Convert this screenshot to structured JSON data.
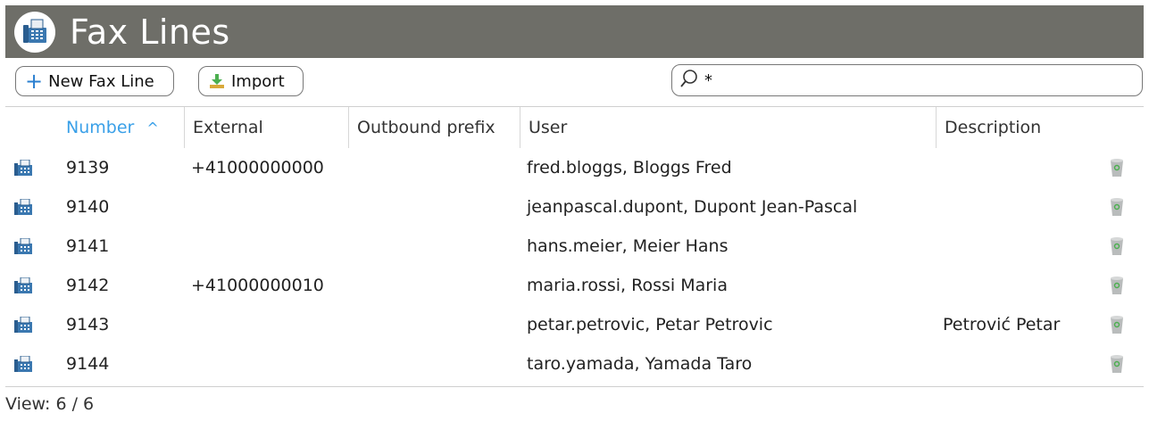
{
  "window": {
    "title": "Fax Lines",
    "title_icon": "fax-machine-icon"
  },
  "toolbar": {
    "new_label": "New Fax Line",
    "import_label": "Import",
    "search_value": "*",
    "search_icon": "search-icon"
  },
  "table": {
    "columns": [
      "Number",
      "External",
      "Outbound prefix",
      "User",
      "Description"
    ],
    "sorted_column": "Number",
    "sort_direction": "ascending",
    "rows": [
      {
        "number": "9139",
        "external": "+41000000000",
        "outbound_prefix": "",
        "user": "fred.bloggs, Bloggs Fred",
        "description": ""
      },
      {
        "number": "9140",
        "external": "",
        "outbound_prefix": "",
        "user": "jeanpascal.dupont, Dupont Jean-Pascal",
        "description": ""
      },
      {
        "number": "9141",
        "external": "",
        "outbound_prefix": "",
        "user": "hans.meier, Meier Hans",
        "description": ""
      },
      {
        "number": "9142",
        "external": "+41000000010",
        "outbound_prefix": "",
        "user": "maria.rossi, Rossi Maria",
        "description": ""
      },
      {
        "number": "9143",
        "external": "",
        "outbound_prefix": "",
        "user": "petar.petrovic, Petar Petrovic",
        "description": "Petrović Petar"
      },
      {
        "number": "9144",
        "external": "",
        "outbound_prefix": "",
        "user": "taro.yamada, Yamada Taro",
        "description": ""
      }
    ]
  },
  "footer": {
    "view_text": "View: 6 / 6"
  },
  "colors": {
    "titlebar_bg": "#6e6e68",
    "accent": "#3aa0e8",
    "delete_icon": "#9fa3a3"
  }
}
